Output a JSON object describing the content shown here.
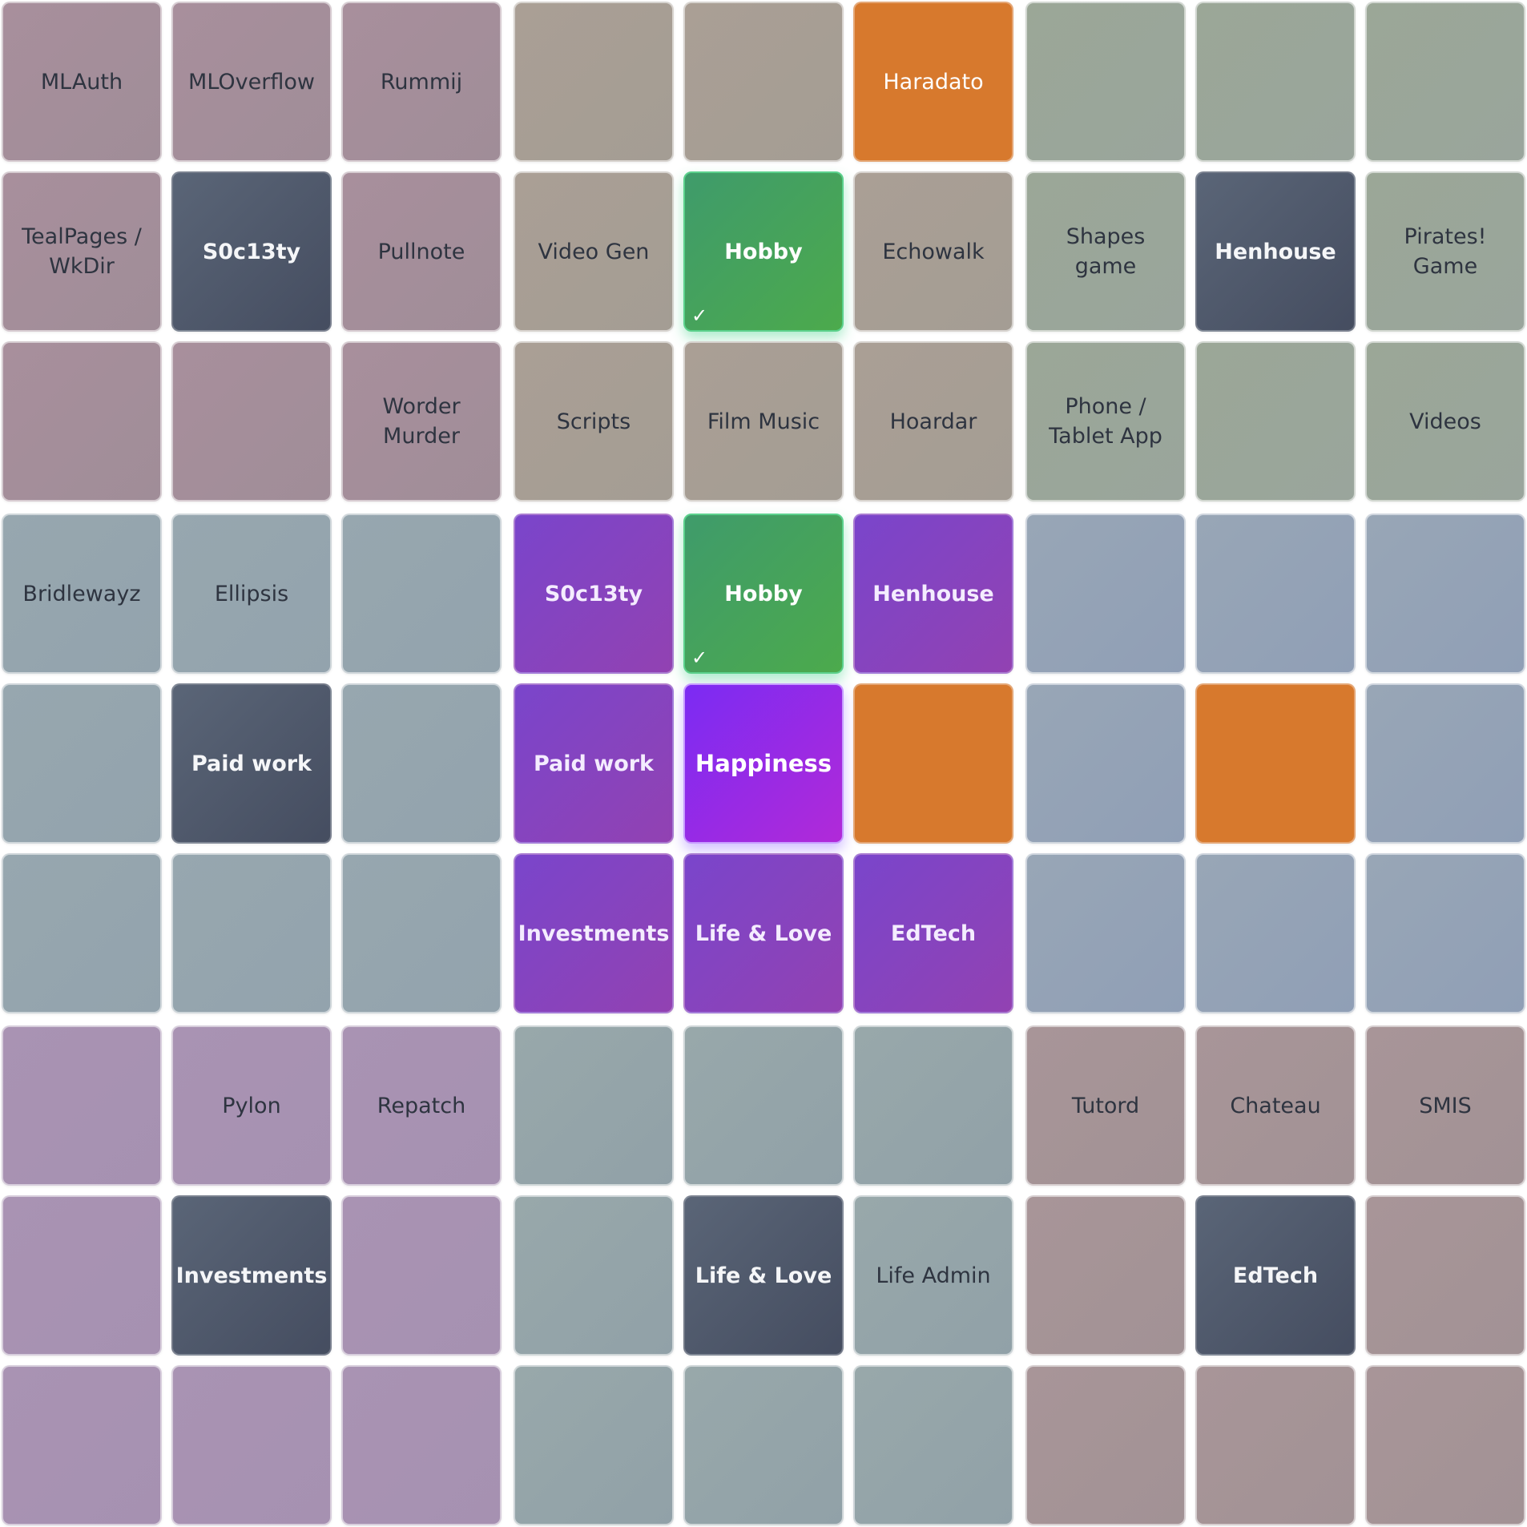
{
  "board": {
    "blocks": [
      {
        "name": "block-top-left",
        "cells": [
          {
            "label": "MLAuth",
            "style": "muted-pink"
          },
          {
            "label": "MLOverflow",
            "style": "muted-pink"
          },
          {
            "label": "Rummij",
            "style": "muted-pink"
          },
          {
            "label": "TealPages /\nWkDir",
            "style": "muted-pink"
          },
          {
            "label": "S0c13ty",
            "style": "dark"
          },
          {
            "label": "Pullnote",
            "style": "muted-pink"
          },
          {
            "label": "",
            "style": "muted-pink"
          },
          {
            "label": "",
            "style": "muted-pink"
          },
          {
            "label": "Worder\nMurder",
            "style": "muted-pink"
          }
        ]
      },
      {
        "name": "block-top-center",
        "cells": [
          {
            "label": "",
            "style": "muted-tan"
          },
          {
            "label": "",
            "style": "muted-tan"
          },
          {
            "label": "Haradato",
            "style": "orange"
          },
          {
            "label": "Video Gen",
            "style": "muted-tan"
          },
          {
            "label": "Hobby",
            "style": "green",
            "checked": true
          },
          {
            "label": "Echowalk",
            "style": "muted-tan"
          },
          {
            "label": "Scripts",
            "style": "muted-tan"
          },
          {
            "label": "Film Music",
            "style": "muted-tan"
          },
          {
            "label": "Hoardar",
            "style": "muted-tan"
          }
        ]
      },
      {
        "name": "block-top-right",
        "cells": [
          {
            "label": "",
            "style": "muted-sage"
          },
          {
            "label": "",
            "style": "muted-sage"
          },
          {
            "label": "",
            "style": "muted-sage"
          },
          {
            "label": "Shapes\ngame",
            "style": "muted-sage"
          },
          {
            "label": "Henhouse",
            "style": "dark"
          },
          {
            "label": "Pirates!\nGame",
            "style": "muted-sage"
          },
          {
            "label": "Phone /\nTablet App",
            "style": "muted-sage"
          },
          {
            "label": "",
            "style": "muted-sage"
          },
          {
            "label": "Videos",
            "style": "muted-sage"
          }
        ]
      },
      {
        "name": "block-middle-left",
        "cells": [
          {
            "label": "Bridlewayz",
            "style": "muted-teal"
          },
          {
            "label": "Ellipsis",
            "style": "muted-teal"
          },
          {
            "label": "",
            "style": "muted-teal"
          },
          {
            "label": "",
            "style": "muted-teal"
          },
          {
            "label": "Paid work",
            "style": "dark"
          },
          {
            "label": "",
            "style": "muted-teal"
          },
          {
            "label": "",
            "style": "muted-teal"
          },
          {
            "label": "",
            "style": "muted-teal"
          },
          {
            "label": "",
            "style": "muted-teal"
          }
        ]
      },
      {
        "name": "block-center",
        "cells": [
          {
            "label": "S0c13ty",
            "style": "purple"
          },
          {
            "label": "Hobby",
            "style": "green",
            "checked": true
          },
          {
            "label": "Henhouse",
            "style": "purple"
          },
          {
            "label": "Paid work",
            "style": "purple"
          },
          {
            "label": "Happiness",
            "style": "happiness"
          },
          {
            "label": "",
            "style": "orange"
          },
          {
            "label": "Investments",
            "style": "purple"
          },
          {
            "label": "Life & Love",
            "style": "purple"
          },
          {
            "label": "EdTech",
            "style": "purple"
          }
        ]
      },
      {
        "name": "block-middle-right",
        "cells": [
          {
            "label": "",
            "style": "muted-bluegrey"
          },
          {
            "label": "",
            "style": "muted-bluegrey"
          },
          {
            "label": "",
            "style": "muted-bluegrey"
          },
          {
            "label": "",
            "style": "muted-bluegrey"
          },
          {
            "label": "",
            "style": "orange"
          },
          {
            "label": "",
            "style": "muted-bluegrey"
          },
          {
            "label": "",
            "style": "muted-bluegrey"
          },
          {
            "label": "",
            "style": "muted-bluegrey"
          },
          {
            "label": "",
            "style": "muted-bluegrey"
          }
        ]
      },
      {
        "name": "block-bottom-left",
        "cells": [
          {
            "label": "",
            "style": "muted-lilac"
          },
          {
            "label": "Pylon",
            "style": "muted-lilac"
          },
          {
            "label": "Repatch",
            "style": "muted-lilac"
          },
          {
            "label": "",
            "style": "muted-lilac"
          },
          {
            "label": "Investments",
            "style": "dark"
          },
          {
            "label": "",
            "style": "muted-lilac"
          },
          {
            "label": "",
            "style": "muted-lilac"
          },
          {
            "label": "",
            "style": "muted-lilac"
          },
          {
            "label": "",
            "style": "muted-lilac"
          }
        ]
      },
      {
        "name": "block-bottom-center",
        "cells": [
          {
            "label": "",
            "style": "muted-slate"
          },
          {
            "label": "",
            "style": "muted-slate"
          },
          {
            "label": "",
            "style": "muted-slate"
          },
          {
            "label": "",
            "style": "muted-slate"
          },
          {
            "label": "Life & Love",
            "style": "dark"
          },
          {
            "label": "Life Admin",
            "style": "muted-slate"
          },
          {
            "label": "",
            "style": "muted-slate"
          },
          {
            "label": "",
            "style": "muted-slate"
          },
          {
            "label": "",
            "style": "muted-slate"
          }
        ]
      },
      {
        "name": "block-bottom-right",
        "cells": [
          {
            "label": "Tutord",
            "style": "muted-rose"
          },
          {
            "label": "Chateau",
            "style": "muted-rose"
          },
          {
            "label": "SMIS",
            "style": "muted-rose"
          },
          {
            "label": "",
            "style": "muted-rose"
          },
          {
            "label": "EdTech",
            "style": "dark"
          },
          {
            "label": "",
            "style": "muted-rose"
          },
          {
            "label": "",
            "style": "muted-rose"
          },
          {
            "label": "",
            "style": "muted-rose"
          },
          {
            "label": "",
            "style": "muted-rose"
          }
        ]
      }
    ],
    "check_glyph": "✓",
    "colors": {
      "accent_orange": "#d7792d",
      "accent_green": "#4caa4c",
      "accent_purple": "#8a44c0",
      "dark_tile": "#4d5669"
    }
  }
}
